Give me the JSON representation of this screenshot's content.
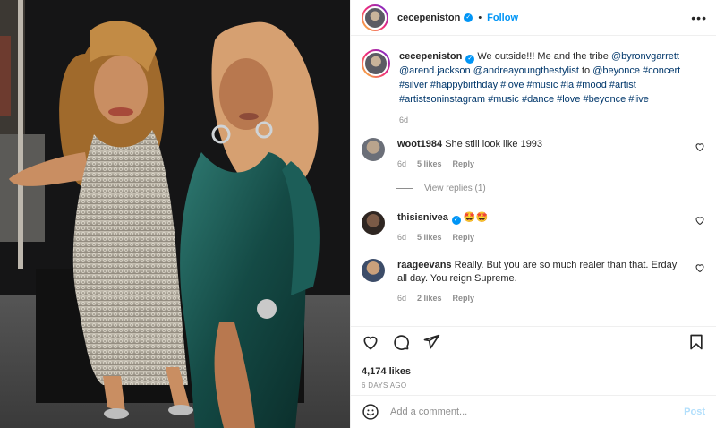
{
  "post": {
    "username": "cecepeniston",
    "follow_label": "Follow",
    "more_label": "•••",
    "caption_text": "We outside!!! Me and the tribe",
    "caption_parts": [
      "@byronvgarrett",
      "@arend.jackson",
      "@andreayoungthestylist",
      "to",
      "@beyonce",
      "#concert",
      "#silver",
      "#happybirthday",
      "#love",
      "#music",
      "#la",
      "#mood",
      "#artist",
      "#artistsoninstagram",
      "#music",
      "#dance",
      "#love",
      "#beyonce",
      "#live"
    ],
    "caption_age": "6d",
    "likes": "4,174 likes",
    "date": "6 DAYS AGO"
  },
  "comments": [
    {
      "user": "woot1984",
      "text": "She still look like 1993",
      "age": "6d",
      "likes": "5 likes",
      "reply": "Reply",
      "verified": false
    },
    {
      "user": "thisisnivea",
      "text": "🤩🤩",
      "age": "6d",
      "likes": "5 likes",
      "reply": "Reply",
      "verified": true
    },
    {
      "user": "raageevans",
      "text": "Really. But you are so much realer than that. Erday all day. You reign Supreme.",
      "age": "6d",
      "likes": "2 likes",
      "reply": "Reply",
      "verified": false
    }
  ],
  "view_replies": "View replies (1)",
  "add_comment": {
    "placeholder": "Add a comment...",
    "post_label": "Post"
  },
  "icons": {
    "like": "heart-icon",
    "comment": "comment-icon",
    "share": "share-icon",
    "save": "bookmark-icon",
    "emoji": "emoji-icon"
  },
  "colors": {
    "link": "#00376b",
    "accent": "#0095f6",
    "muted": "#8e8e8e",
    "post_disabled": "#b2dffc"
  }
}
